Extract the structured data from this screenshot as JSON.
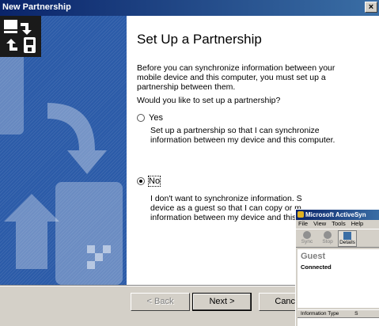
{
  "window": {
    "title": "New Partnership",
    "close_glyph": "×"
  },
  "content": {
    "heading": "Set Up a Partnership",
    "intro": "Before you can synchronize information between your mobile device and this computer, you must set up a partnership between them.",
    "question": "Would you like to set up a partnership?",
    "options": [
      {
        "label": "Yes",
        "checked": false,
        "description": "Set up a partnership so that I can synchronize information between my device and this computer."
      },
      {
        "label": "No",
        "checked": true,
        "description": "I don't want to synchronize information. S device as a guest so that I can copy or m information between my device and this c"
      }
    ]
  },
  "buttons": {
    "back": "< Back",
    "next": "Next >",
    "cancel": "Cancel"
  },
  "activesync": {
    "title": "Microsoft ActiveSyn",
    "menu": [
      "File",
      "View",
      "Tools",
      "Help"
    ],
    "toolbar": [
      {
        "label": "Sync",
        "icon": "sync-icon"
      },
      {
        "label": "Stop",
        "icon": "stop-icon"
      },
      {
        "label": "Details",
        "icon": "details-icon"
      }
    ],
    "status_name": "Guest",
    "status_text": "Connected",
    "column_header": "Information Type",
    "column_header_2": "S"
  },
  "colors": {
    "titlebar_start": "#0a246a",
    "titlebar_end": "#3a6ea5",
    "panel_blue": "#2b5ba8"
  },
  "icons": [
    "close-icon",
    "sync-partnership-icon",
    "radio-icon"
  ]
}
